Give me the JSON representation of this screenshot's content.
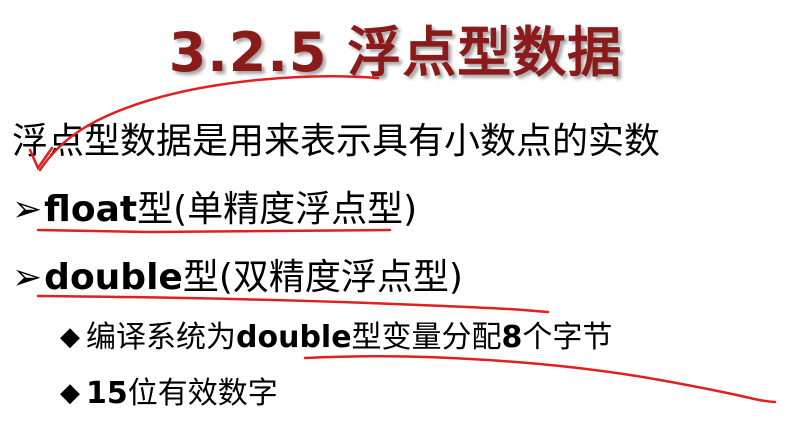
{
  "title": "3.2.5 浮点型数据",
  "intro": "浮点型数据是用来表示具有小数点的实数",
  "bullets": [
    {
      "marker": "➢",
      "keyword": "float",
      "suffix": "型",
      "paren": "(单精度浮点型)"
    },
    {
      "marker": "➢",
      "keyword": "double",
      "suffix": "型",
      "paren": "(双精度浮点型)"
    }
  ],
  "sub_bullets": [
    {
      "marker": "◆",
      "pre": "编译系统为",
      "keyword": "double",
      "mid": "型变量分配",
      "num": "8",
      "post": "个字节"
    },
    {
      "marker": "◆",
      "num": "15",
      "post": "位有效数字"
    }
  ],
  "colors": {
    "title": "#8b1a1a",
    "annotation": "#e02020"
  }
}
